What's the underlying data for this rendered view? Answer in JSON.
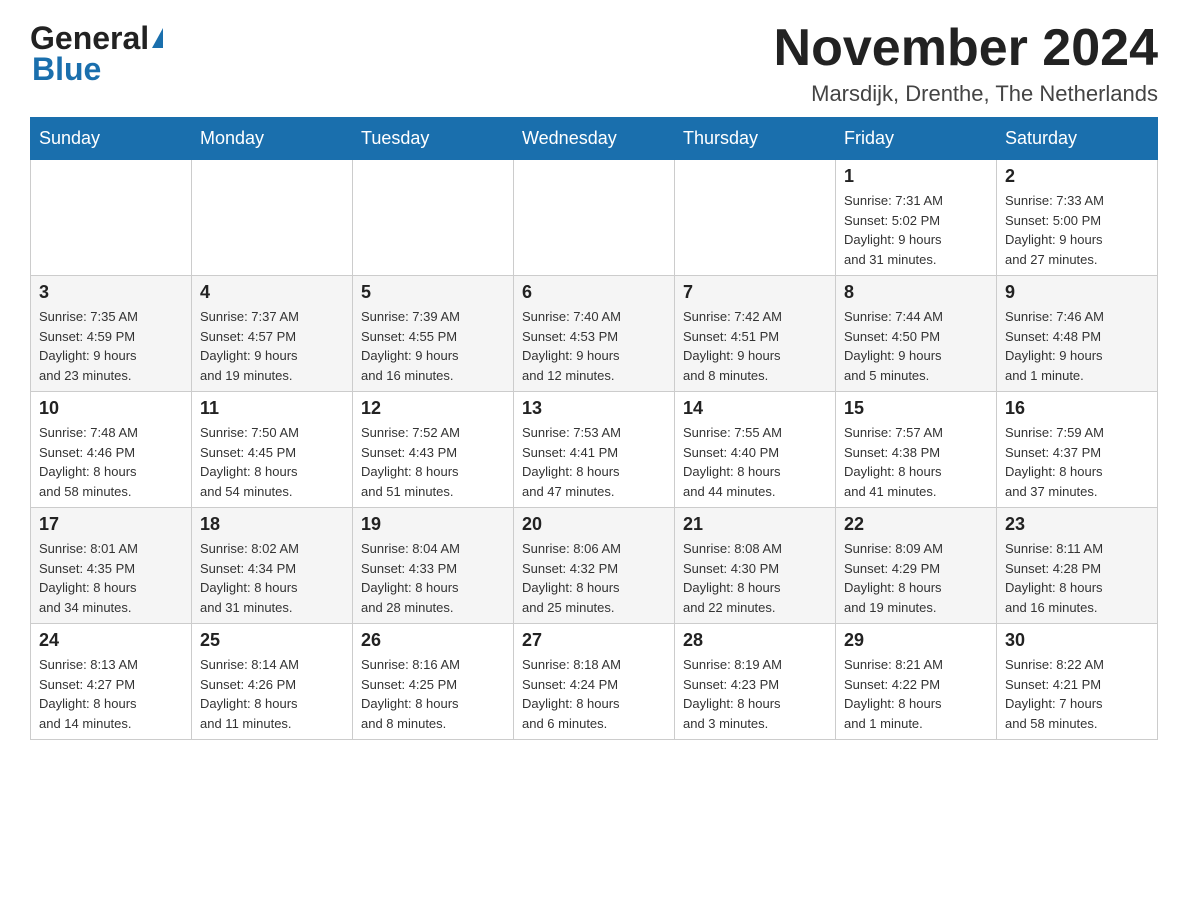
{
  "header": {
    "logo_general": "General",
    "logo_blue": "Blue",
    "month_title": "November 2024",
    "location": "Marsdijk, Drenthe, The Netherlands"
  },
  "weekdays": [
    "Sunday",
    "Monday",
    "Tuesday",
    "Wednesday",
    "Thursday",
    "Friday",
    "Saturday"
  ],
  "rows": [
    [
      {
        "day": "",
        "info": ""
      },
      {
        "day": "",
        "info": ""
      },
      {
        "day": "",
        "info": ""
      },
      {
        "day": "",
        "info": ""
      },
      {
        "day": "",
        "info": ""
      },
      {
        "day": "1",
        "info": "Sunrise: 7:31 AM\nSunset: 5:02 PM\nDaylight: 9 hours\nand 31 minutes."
      },
      {
        "day": "2",
        "info": "Sunrise: 7:33 AM\nSunset: 5:00 PM\nDaylight: 9 hours\nand 27 minutes."
      }
    ],
    [
      {
        "day": "3",
        "info": "Sunrise: 7:35 AM\nSunset: 4:59 PM\nDaylight: 9 hours\nand 23 minutes."
      },
      {
        "day": "4",
        "info": "Sunrise: 7:37 AM\nSunset: 4:57 PM\nDaylight: 9 hours\nand 19 minutes."
      },
      {
        "day": "5",
        "info": "Sunrise: 7:39 AM\nSunset: 4:55 PM\nDaylight: 9 hours\nand 16 minutes."
      },
      {
        "day": "6",
        "info": "Sunrise: 7:40 AM\nSunset: 4:53 PM\nDaylight: 9 hours\nand 12 minutes."
      },
      {
        "day": "7",
        "info": "Sunrise: 7:42 AM\nSunset: 4:51 PM\nDaylight: 9 hours\nand 8 minutes."
      },
      {
        "day": "8",
        "info": "Sunrise: 7:44 AM\nSunset: 4:50 PM\nDaylight: 9 hours\nand 5 minutes."
      },
      {
        "day": "9",
        "info": "Sunrise: 7:46 AM\nSunset: 4:48 PM\nDaylight: 9 hours\nand 1 minute."
      }
    ],
    [
      {
        "day": "10",
        "info": "Sunrise: 7:48 AM\nSunset: 4:46 PM\nDaylight: 8 hours\nand 58 minutes."
      },
      {
        "day": "11",
        "info": "Sunrise: 7:50 AM\nSunset: 4:45 PM\nDaylight: 8 hours\nand 54 minutes."
      },
      {
        "day": "12",
        "info": "Sunrise: 7:52 AM\nSunset: 4:43 PM\nDaylight: 8 hours\nand 51 minutes."
      },
      {
        "day": "13",
        "info": "Sunrise: 7:53 AM\nSunset: 4:41 PM\nDaylight: 8 hours\nand 47 minutes."
      },
      {
        "day": "14",
        "info": "Sunrise: 7:55 AM\nSunset: 4:40 PM\nDaylight: 8 hours\nand 44 minutes."
      },
      {
        "day": "15",
        "info": "Sunrise: 7:57 AM\nSunset: 4:38 PM\nDaylight: 8 hours\nand 41 minutes."
      },
      {
        "day": "16",
        "info": "Sunrise: 7:59 AM\nSunset: 4:37 PM\nDaylight: 8 hours\nand 37 minutes."
      }
    ],
    [
      {
        "day": "17",
        "info": "Sunrise: 8:01 AM\nSunset: 4:35 PM\nDaylight: 8 hours\nand 34 minutes."
      },
      {
        "day": "18",
        "info": "Sunrise: 8:02 AM\nSunset: 4:34 PM\nDaylight: 8 hours\nand 31 minutes."
      },
      {
        "day": "19",
        "info": "Sunrise: 8:04 AM\nSunset: 4:33 PM\nDaylight: 8 hours\nand 28 minutes."
      },
      {
        "day": "20",
        "info": "Sunrise: 8:06 AM\nSunset: 4:32 PM\nDaylight: 8 hours\nand 25 minutes."
      },
      {
        "day": "21",
        "info": "Sunrise: 8:08 AM\nSunset: 4:30 PM\nDaylight: 8 hours\nand 22 minutes."
      },
      {
        "day": "22",
        "info": "Sunrise: 8:09 AM\nSunset: 4:29 PM\nDaylight: 8 hours\nand 19 minutes."
      },
      {
        "day": "23",
        "info": "Sunrise: 8:11 AM\nSunset: 4:28 PM\nDaylight: 8 hours\nand 16 minutes."
      }
    ],
    [
      {
        "day": "24",
        "info": "Sunrise: 8:13 AM\nSunset: 4:27 PM\nDaylight: 8 hours\nand 14 minutes."
      },
      {
        "day": "25",
        "info": "Sunrise: 8:14 AM\nSunset: 4:26 PM\nDaylight: 8 hours\nand 11 minutes."
      },
      {
        "day": "26",
        "info": "Sunrise: 8:16 AM\nSunset: 4:25 PM\nDaylight: 8 hours\nand 8 minutes."
      },
      {
        "day": "27",
        "info": "Sunrise: 8:18 AM\nSunset: 4:24 PM\nDaylight: 8 hours\nand 6 minutes."
      },
      {
        "day": "28",
        "info": "Sunrise: 8:19 AM\nSunset: 4:23 PM\nDaylight: 8 hours\nand 3 minutes."
      },
      {
        "day": "29",
        "info": "Sunrise: 8:21 AM\nSunset: 4:22 PM\nDaylight: 8 hours\nand 1 minute."
      },
      {
        "day": "30",
        "info": "Sunrise: 8:22 AM\nSunset: 4:21 PM\nDaylight: 7 hours\nand 58 minutes."
      }
    ]
  ],
  "colors": {
    "header_bg": "#1a6fad",
    "header_text": "#ffffff",
    "border": "#cccccc",
    "row_even_bg": "#f0f0f0",
    "row_odd_bg": "#ffffff"
  }
}
